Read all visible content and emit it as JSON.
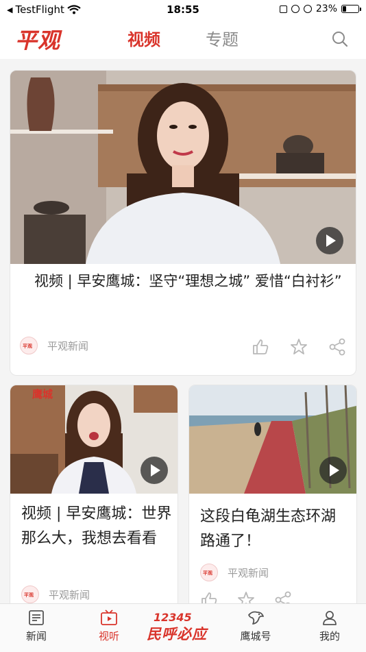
{
  "status_bar": {
    "back_app": "TestFlight",
    "time": "18:55",
    "battery_text": "23%",
    "battery_level": 0.23
  },
  "header": {
    "logo": "平观",
    "tabs": [
      {
        "label": "视频",
        "active": true
      },
      {
        "label": "专题",
        "active": false
      }
    ]
  },
  "feed": [
    {
      "title": "视频 | 早安鹰城：坚守“理想之城” 爱惜“白衬衫”",
      "source": "平观新闻"
    },
    {
      "title": "视频 | 早安鹰城：世界那么大，我想去看看",
      "source": "平观新闻"
    },
    {
      "title": "这段白龟湖生态环湖路通了！",
      "source": "平观新闻"
    }
  ],
  "thumb2_badge": "鹰城",
  "bottom_nav": {
    "items": [
      {
        "label": "新闻"
      },
      {
        "label": "视听"
      },
      {
        "label": "鹰城号"
      },
      {
        "label": "我的"
      }
    ],
    "hotline_number": "12345",
    "hotline_text": "民呼必应"
  },
  "colors": {
    "brand": "#d9342b",
    "inactive_tab": "#8a8a8a",
    "meta_text": "#9a9a9a"
  }
}
